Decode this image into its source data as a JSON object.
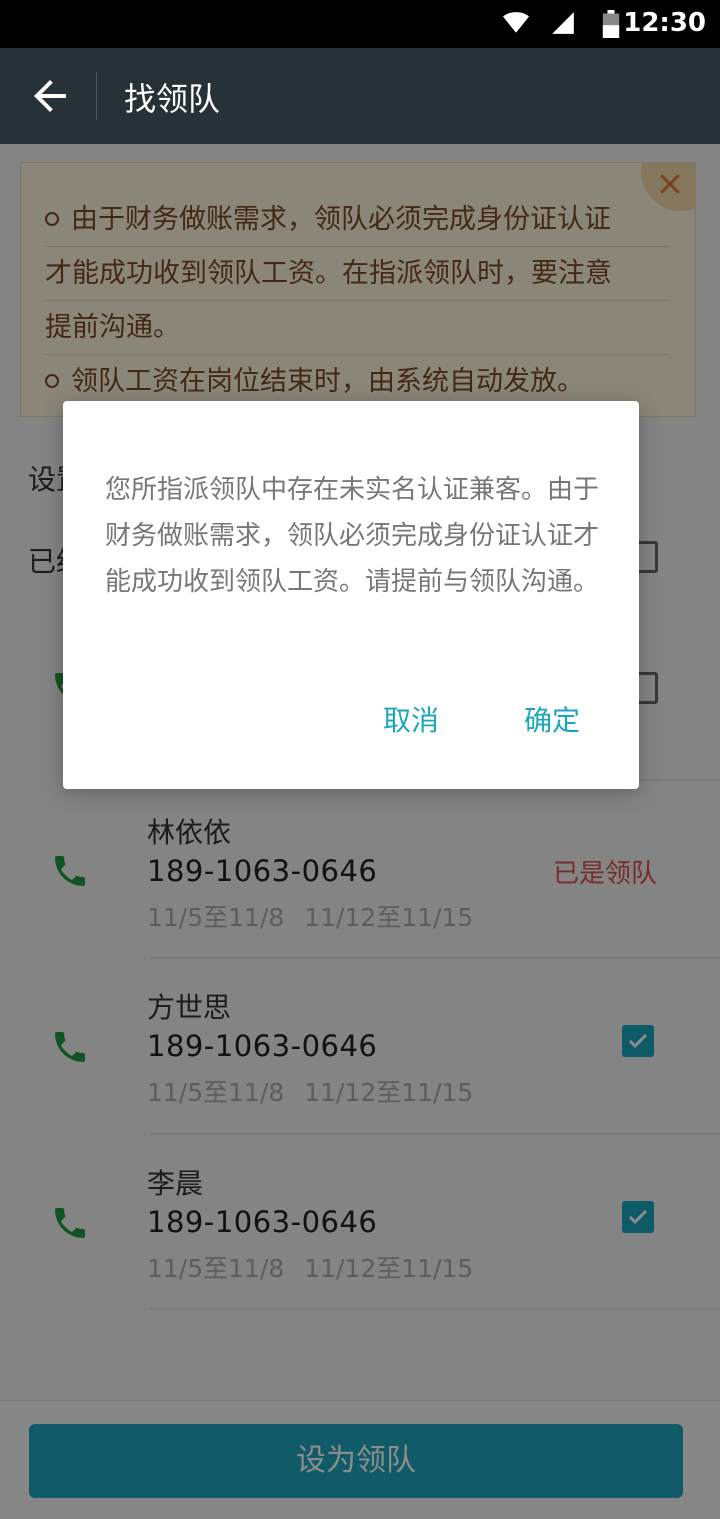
{
  "status_bar": {
    "time": "12:30"
  },
  "app_bar": {
    "title": "找领队"
  },
  "notice": {
    "lines": [
      "由于财务做账需求，领队必须完成身份证认证",
      "才能成功收到领队工资。在指派领队时，要注意",
      "提前沟通。",
      "领队工资在岗位结束时，由系统自动发放。"
    ]
  },
  "sections": {
    "label_1": "设置",
    "label_2": "已经"
  },
  "members": [
    {
      "name": "林依依",
      "phone": "189-1063-0646",
      "dates": "11/5至11/8 11/12至11/15",
      "status": "已是领队"
    },
    {
      "name": "方世思",
      "phone": "189-1063-0646",
      "dates": "11/5至11/8 11/12至11/15",
      "checked": true
    },
    {
      "name": "李晨",
      "phone": "189-1063-0646",
      "dates": "11/5至11/8 11/12至11/15",
      "checked": true
    }
  ],
  "primary_button": {
    "label": "设为领队"
  },
  "dialog": {
    "message": "您所指派领队中存在未实名认证兼客。由于财务做账需求，领队必须完成身份证认证才能成功收到领队工资。请提前与领队沟通。",
    "cancel_label": "取消",
    "ok_label": "确定"
  },
  "colors": {
    "app_bar": "#263238",
    "accent": "#1aa6bd",
    "phone_icon": "#1f9a3c",
    "status_red": "#d9534f"
  }
}
